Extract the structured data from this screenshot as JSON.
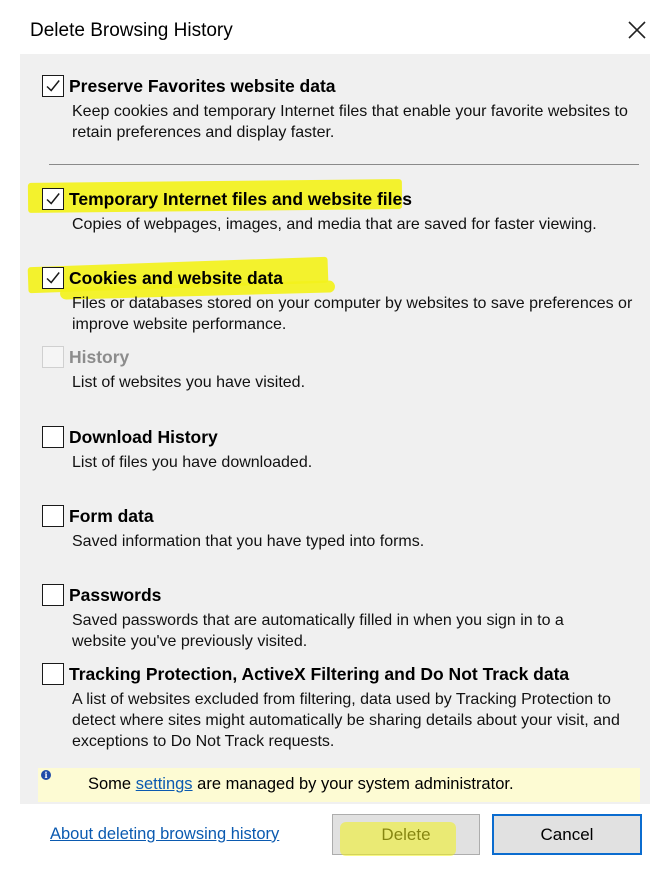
{
  "dialog": {
    "title": "Delete Browsing History",
    "close_glyph": "×"
  },
  "options": [
    {
      "title": "Preserve Favorites website data",
      "description": "Keep cookies and temporary Internet files that enable your favorite websites to retain preferences and display faster.",
      "checked": true,
      "enabled": true
    },
    {
      "title": "Temporary Internet files and website files",
      "description": "Copies of webpages, images, and media that are saved for faster viewing.",
      "checked": true,
      "enabled": true
    },
    {
      "title": "Cookies and website data",
      "description": "Files or databases stored on your computer by websites to save preferences or improve website performance.",
      "checked": true,
      "enabled": true
    },
    {
      "title": "History",
      "description": "List of websites you have visited.",
      "checked": false,
      "enabled": false
    },
    {
      "title": "Download History",
      "description": "List of files you have downloaded.",
      "checked": false,
      "enabled": true
    },
    {
      "title": "Form data",
      "description": "Saved information that you have typed into forms.",
      "checked": false,
      "enabled": true
    },
    {
      "title": "Passwords",
      "description": "Saved passwords that are automatically filled in when you sign in to a website you've previously visited.",
      "checked": false,
      "enabled": true
    },
    {
      "title": "Tracking Protection, ActiveX Filtering and Do Not Track data",
      "description": "A list of websites excluded from filtering, data used by Tracking Protection to detect where sites might automatically be sharing details about your visit, and exceptions to Do Not Track requests.",
      "checked": false,
      "enabled": true
    }
  ],
  "info": {
    "icon": "info-icon",
    "icon_glyph": "i",
    "text_before": "Some ",
    "link_text": "settings",
    "text_after": " are managed by your system administrator."
  },
  "footer": {
    "about_link": "About deleting browsing history",
    "delete_label": "Delete",
    "cancel_label": "Cancel"
  },
  "colors": {
    "highlight": "#f3f21c",
    "link": "#0b5ab0",
    "default_button_border": "#0b6ccf",
    "info_bar": "#fdfbd3"
  }
}
